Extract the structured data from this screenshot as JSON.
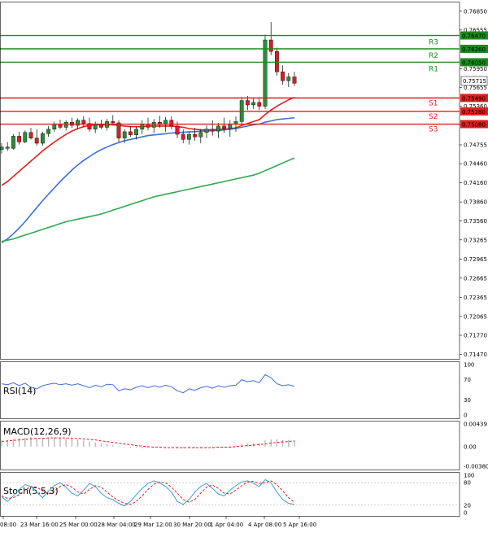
{
  "colors": {
    "background": "#ffffff",
    "frame": "#000000",
    "bull_candle": "#2e8b3a",
    "bear_candle": "#d81e1e",
    "support": "#e21e1e",
    "resistance": "#1a8a1a",
    "ma_fast": "#e21e1e",
    "ma_mid": "#3d6fd8",
    "ma_slow": "#2fa84f",
    "rsi": "#3d6fd8",
    "macd_hist": "#b8b8b8",
    "macd_signal": "#e21e1e",
    "stoch_main": "#3d9bd8",
    "stoch_signal": "#e21e1e",
    "price_label_bg": "#ffffff",
    "current_label_bg": "#ffffff"
  },
  "main_axis": {
    "ticks": [
      "0.76850",
      "0.76555",
      "0.75950",
      "0.75655",
      "0.75360",
      "0.75065",
      "0.74755",
      "0.74460",
      "0.74160",
      "0.73860",
      "0.73560",
      "0.73265",
      "0.72965",
      "0.72665",
      "0.72365",
      "0.72065",
      "0.71770",
      "0.71470"
    ]
  },
  "x_axis": {
    "ticks": [
      "08:00",
      "23 Mar 16:00",
      "25 Mar 00:00",
      "28 Mar 04:00",
      "29 Mar 12:00",
      "30 Mar 20:00",
      "1 Apr 04:00",
      "4 Apr 08:00",
      "5 Apr 16:00"
    ]
  },
  "levels": [
    {
      "name": "R3",
      "label": "R3",
      "price_label": "0.76470",
      "type": "resistance"
    },
    {
      "name": "R2",
      "label": "R2",
      "price_label": "0.76260",
      "type": "resistance"
    },
    {
      "name": "R1",
      "label": "R1",
      "price_label": "0.76050",
      "type": "resistance"
    },
    {
      "name": "S1",
      "label": "S1",
      "price_label": "0.75490",
      "type": "support"
    },
    {
      "name": "S2",
      "label": "S2",
      "price_label": "0.75280",
      "type": "support"
    },
    {
      "name": "S3",
      "label": "S3",
      "price_label": "0.75080",
      "type": "support"
    }
  ],
  "current_price_label": "0.75715",
  "indicators": {
    "rsi": {
      "title": "RSI(14)",
      "ticks": [
        "100",
        "70",
        "30",
        "0"
      ]
    },
    "macd": {
      "title": "MACD(12,26,9)",
      "ticks": [
        "0.004391",
        "0.00",
        "-0.003806"
      ]
    },
    "stoch": {
      "title": "Stoch(5,5,3)",
      "ticks": [
        "100",
        "80",
        "20",
        "0"
      ]
    }
  },
  "chart_data": {
    "type": "candlestick",
    "symbol_timeframe_note": "",
    "ylim": [
      0.714,
      0.77
    ],
    "x_categories": [
      "08:00",
      "23 Mar 16:00",
      "25 Mar 00:00",
      "28 Mar 04:00",
      "29 Mar 12:00",
      "30 Mar 20:00",
      "1 Apr 04:00",
      "4 Apr 08:00",
      "5 Apr 16:00"
    ],
    "candles": [
      [
        0.7468,
        0.7478,
        0.7462,
        0.7472
      ],
      [
        0.7472,
        0.748,
        0.7466,
        0.747
      ],
      [
        0.747,
        0.7492,
        0.7468,
        0.7489
      ],
      [
        0.7489,
        0.7496,
        0.7476,
        0.748
      ],
      [
        0.748,
        0.7498,
        0.7478,
        0.7495
      ],
      [
        0.7495,
        0.7502,
        0.7484,
        0.7486
      ],
      [
        0.7486,
        0.75,
        0.7474,
        0.7478
      ],
      [
        0.7478,
        0.7496,
        0.7474,
        0.7493
      ],
      [
        0.7493,
        0.7505,
        0.7488,
        0.75
      ],
      [
        0.75,
        0.7512,
        0.7496,
        0.7508
      ],
      [
        0.7508,
        0.7515,
        0.75,
        0.7503
      ],
      [
        0.7503,
        0.7514,
        0.7498,
        0.7511
      ],
      [
        0.7511,
        0.7518,
        0.7502,
        0.7506
      ],
      [
        0.7506,
        0.7517,
        0.75,
        0.7514
      ],
      [
        0.7514,
        0.752,
        0.7504,
        0.7509
      ],
      [
        0.7509,
        0.7518,
        0.7496,
        0.75
      ],
      [
        0.75,
        0.7512,
        0.7494,
        0.7507
      ],
      [
        0.7507,
        0.7515,
        0.75,
        0.7503
      ],
      [
        0.7503,
        0.7516,
        0.7498,
        0.7512
      ],
      [
        0.7512,
        0.7522,
        0.7506,
        0.751
      ],
      [
        0.751,
        0.7514,
        0.748,
        0.7486
      ],
      [
        0.7486,
        0.75,
        0.7478,
        0.7496
      ],
      [
        0.7496,
        0.7505,
        0.7488,
        0.7491
      ],
      [
        0.7491,
        0.7504,
        0.7484,
        0.75
      ],
      [
        0.75,
        0.7514,
        0.7492,
        0.7508
      ],
      [
        0.7508,
        0.7518,
        0.7498,
        0.7503
      ],
      [
        0.7503,
        0.7516,
        0.7494,
        0.7511
      ],
      [
        0.7511,
        0.7521,
        0.7502,
        0.7507
      ],
      [
        0.7507,
        0.7519,
        0.7496,
        0.7514
      ],
      [
        0.7514,
        0.752,
        0.75,
        0.7505
      ],
      [
        0.7505,
        0.7512,
        0.7486,
        0.7492
      ],
      [
        0.7492,
        0.75,
        0.7478,
        0.7484
      ],
      [
        0.7484,
        0.7496,
        0.7476,
        0.7492
      ],
      [
        0.7492,
        0.7502,
        0.7482,
        0.7488
      ],
      [
        0.7488,
        0.75,
        0.7478,
        0.7495
      ],
      [
        0.7495,
        0.7506,
        0.7486,
        0.75
      ],
      [
        0.75,
        0.7514,
        0.749,
        0.7497
      ],
      [
        0.7497,
        0.751,
        0.7486,
        0.7505
      ],
      [
        0.7505,
        0.7518,
        0.7494,
        0.7501
      ],
      [
        0.7501,
        0.7514,
        0.7488,
        0.7508
      ],
      [
        0.7508,
        0.752,
        0.7496,
        0.7512
      ],
      [
        0.7512,
        0.755,
        0.7508,
        0.7545
      ],
      [
        0.7545,
        0.7552,
        0.753,
        0.7538
      ],
      [
        0.7538,
        0.7548,
        0.7532,
        0.7542
      ],
      [
        0.7542,
        0.7548,
        0.753,
        0.7536
      ],
      [
        0.7536,
        0.7648,
        0.7532,
        0.764
      ],
      [
        0.764,
        0.7668,
        0.7616,
        0.7622
      ],
      [
        0.7622,
        0.7628,
        0.7584,
        0.759
      ],
      [
        0.759,
        0.76,
        0.757,
        0.7576
      ],
      [
        0.7576,
        0.7588,
        0.7566,
        0.7582
      ],
      [
        0.7582,
        0.759,
        0.7568,
        0.7572
      ]
    ],
    "moving_averages": [
      {
        "name": "",
        "color_key": "ma_fast",
        "values": [
          0.7412,
          0.7418,
          0.7426,
          0.7434,
          0.7442,
          0.745,
          0.7458,
          0.7466,
          0.7473,
          0.748,
          0.7486,
          0.7492,
          0.7497,
          0.7501,
          0.7504,
          0.7506,
          0.7507,
          0.7507,
          0.7507,
          0.7507,
          0.7506,
          0.7505,
          0.7504,
          0.7504,
          0.7504,
          0.7505,
          0.7505,
          0.7505,
          0.7505,
          0.7505,
          0.7504,
          0.7503,
          0.7501,
          0.75,
          0.7499,
          0.7499,
          0.7499,
          0.75,
          0.75,
          0.7501,
          0.7502,
          0.7506,
          0.7509,
          0.7512,
          0.7515,
          0.7523,
          0.753,
          0.7536,
          0.7541,
          0.7546,
          0.755
        ]
      },
      {
        "name": "",
        "color_key": "ma_mid",
        "values": [
          0.7322,
          0.7328,
          0.7336,
          0.7345,
          0.7355,
          0.7366,
          0.7377,
          0.7388,
          0.7398,
          0.7408,
          0.7418,
          0.7427,
          0.7436,
          0.7444,
          0.7451,
          0.7457,
          0.7463,
          0.7468,
          0.7472,
          0.7476,
          0.7479,
          0.7482,
          0.7484,
          0.7486,
          0.7488,
          0.749,
          0.7491,
          0.7492,
          0.7493,
          0.7494,
          0.7495,
          0.7495,
          0.7496,
          0.7496,
          0.7497,
          0.7497,
          0.7498,
          0.7498,
          0.7499,
          0.75,
          0.7501,
          0.7503,
          0.7505,
          0.7507,
          0.7508,
          0.7511,
          0.7513,
          0.7515,
          0.7516,
          0.7517,
          0.7518
        ]
      },
      {
        "name": "",
        "color_key": "ma_slow",
        "values": [
          0.7324,
          0.7326,
          0.7328,
          0.7331,
          0.7334,
          0.7337,
          0.734,
          0.7343,
          0.7346,
          0.7349,
          0.7352,
          0.7355,
          0.7357,
          0.7359,
          0.7361,
          0.7363,
          0.7365,
          0.7367,
          0.737,
          0.7373,
          0.7376,
          0.7379,
          0.7382,
          0.7385,
          0.7388,
          0.7391,
          0.7394,
          0.7396,
          0.7398,
          0.74,
          0.7402,
          0.7404,
          0.7406,
          0.7408,
          0.741,
          0.7412,
          0.7414,
          0.7416,
          0.7418,
          0.742,
          0.7422,
          0.7424,
          0.7426,
          0.7428,
          0.7431,
          0.7435,
          0.7439,
          0.7443,
          0.7447,
          0.7451,
          0.7455
        ]
      }
    ],
    "rsi_values": [
      62,
      60,
      64,
      58,
      63,
      55,
      52,
      58,
      61,
      63,
      60,
      62,
      59,
      62,
      58,
      54,
      59,
      56,
      61,
      60,
      48,
      52,
      50,
      55,
      58,
      54,
      58,
      55,
      59,
      56,
      48,
      44,
      52,
      49,
      54,
      57,
      53,
      58,
      55,
      58,
      59,
      70,
      66,
      68,
      64,
      80,
      74,
      62,
      58,
      60,
      57
    ],
    "macd_hist": [
      0.0012,
      0.0013,
      0.0015,
      0.0016,
      0.0017,
      0.0018,
      0.0017,
      0.0017,
      0.0018,
      0.0018,
      0.0017,
      0.0016,
      0.0015,
      0.0014,
      0.0012,
      0.001,
      0.0008,
      0.0006,
      0.0005,
      0.0003,
      0.0001,
      -0.0001,
      -0.0002,
      -0.0002,
      -0.0003,
      -0.0002,
      -0.0002,
      -0.0002,
      -0.0001,
      -0.0001,
      -0.0002,
      -0.0003,
      -0.0003,
      -0.0003,
      -0.0002,
      -0.0002,
      -0.0001,
      -0.0001,
      0.0,
      0.0001,
      0.0002,
      0.0005,
      0.0006,
      0.0007,
      0.0007,
      0.0012,
      0.0014,
      0.0014,
      0.0013,
      0.0013,
      0.0012
    ],
    "macd_signal": [
      0.001,
      0.0011,
      0.0012,
      0.0013,
      0.0014,
      0.0015,
      0.0016,
      0.0016,
      0.0017,
      0.0017,
      0.0017,
      0.0017,
      0.0016,
      0.0016,
      0.0015,
      0.0014,
      0.0013,
      0.0011,
      0.001,
      0.0008,
      0.0007,
      0.0005,
      0.0004,
      0.0002,
      0.0001,
      0.0,
      -0.0001,
      -0.0001,
      -0.0002,
      -0.0002,
      -0.0002,
      -0.0002,
      -0.0002,
      -0.0002,
      -0.0002,
      -0.0002,
      -0.0002,
      -0.0001,
      -0.0001,
      -0.0001,
      0.0,
      0.0001,
      0.0002,
      0.0003,
      0.0004,
      0.0005,
      0.0007,
      0.0008,
      0.0009,
      0.001,
      0.0011
    ],
    "stoch_main": [
      42,
      30,
      45,
      62,
      75,
      70,
      55,
      40,
      58,
      72,
      80,
      68,
      52,
      45,
      60,
      78,
      70,
      52,
      40,
      35,
      25,
      18,
      30,
      48,
      65,
      78,
      85,
      80,
      70,
      55,
      30,
      22,
      35,
      55,
      70,
      78,
      65,
      50,
      45,
      60,
      72,
      82,
      85,
      78,
      70,
      88,
      80,
      55,
      35,
      25,
      22
    ],
    "stoch_signal": [
      45,
      38,
      40,
      48,
      60,
      70,
      68,
      58,
      50,
      58,
      70,
      75,
      68,
      55,
      50,
      62,
      72,
      68,
      55,
      42,
      32,
      25,
      22,
      30,
      45,
      62,
      76,
      82,
      80,
      68,
      52,
      35,
      28,
      35,
      52,
      68,
      74,
      65,
      52,
      50,
      60,
      72,
      82,
      84,
      78,
      80,
      85,
      75,
      58,
      40,
      28
    ]
  }
}
